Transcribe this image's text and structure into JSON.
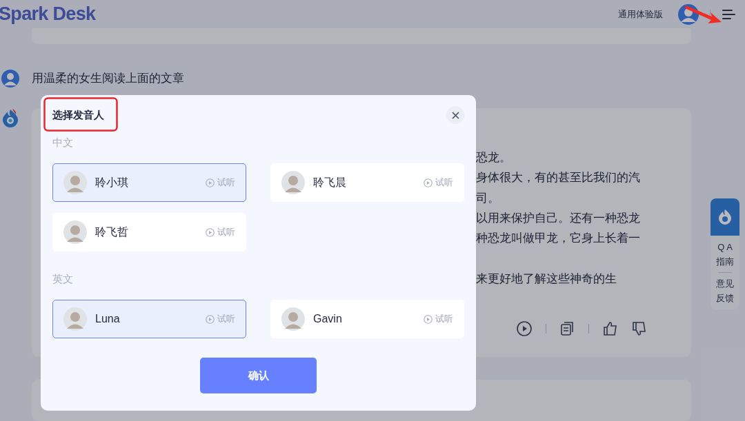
{
  "header": {
    "logo": "Spark Desk",
    "edition": "通用体验版"
  },
  "messages": [
    {
      "kind": "user",
      "text": "用温柔的女生阅读上面的文章"
    },
    {
      "kind": "assistant",
      "paragraphs": [
        [
          "恐龙。",
          "身体很大，有的甚至比我们的汽",
          "司。",
          "以用来保护自己。还有一种恐龙",
          "种恐龙叫做甲龙，它身上长着一"
        ],
        [
          "来更好地了解这些神奇的生"
        ]
      ]
    }
  ],
  "side_panel": {
    "groups": [
      [
        "Q A",
        "指南"
      ],
      [
        "意见",
        "反馈"
      ]
    ]
  },
  "dialog": {
    "title": "选择发音人",
    "sections": [
      {
        "label": "中文",
        "voices": [
          {
            "name": "聆小琪",
            "selected": true,
            "preview": "试听"
          },
          {
            "name": "聆飞晨",
            "selected": false,
            "preview": "试听"
          },
          {
            "name": "聆飞哲",
            "selected": false,
            "preview": "试听"
          }
        ]
      },
      {
        "label": "英文",
        "voices": [
          {
            "name": "Luna",
            "selected": true,
            "preview": "试听"
          },
          {
            "name": "Gavin",
            "selected": false,
            "preview": "试听"
          }
        ]
      }
    ],
    "confirm": "确认"
  }
}
